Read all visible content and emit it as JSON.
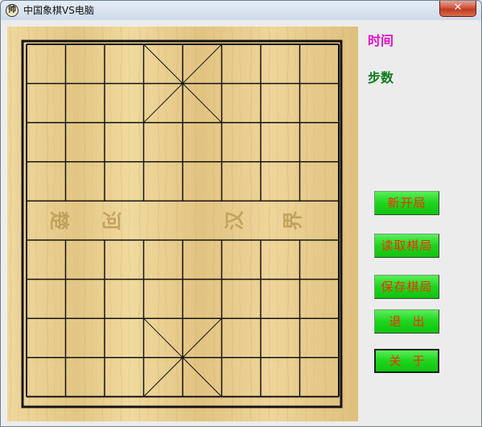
{
  "window": {
    "title": "中国象棋VS电脑",
    "icon": "chess-app-icon",
    "icon_glyph": "帅",
    "close_glyph": "✕"
  },
  "board": {
    "files": 9,
    "ranks": 10,
    "river_text": [
      "楚",
      "河",
      "汉",
      "界"
    ],
    "line_color": "#141414",
    "wood_color": "#e8cf8f"
  },
  "side_panel": {
    "time_label": "时间",
    "steps_label": "步数",
    "time_color": "#e010c8",
    "steps_color": "#0e7a1e"
  },
  "buttons": {
    "new_game": "新开局",
    "load_game": "读取棋局",
    "save_game": "保存棋局",
    "exit": "退出",
    "about": "关于"
  },
  "colors": {
    "button_green": "#1ed41e",
    "button_text_red": "#ff2a10"
  }
}
